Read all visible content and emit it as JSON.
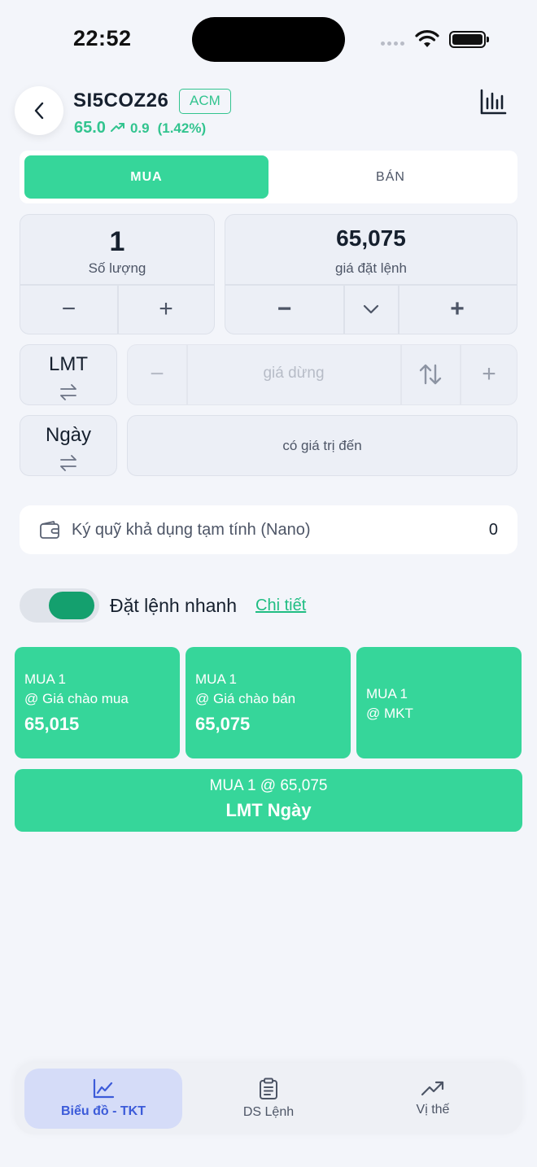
{
  "status_bar": {
    "time": "22:52"
  },
  "header": {
    "symbol": "SI5COZ26",
    "exchange_badge": "ACM",
    "last_price": "65.0",
    "change": "0.9",
    "change_pct": "(1.42%)",
    "trend_color": "#32c48f"
  },
  "side_tabs": {
    "buy": "MUA",
    "sell": "BÁN",
    "selected": "buy"
  },
  "quantity": {
    "value": "1",
    "label": "Số lượng",
    "minus": "−",
    "plus": "+"
  },
  "order_price": {
    "value": "65,075",
    "label": "giá đặt lệnh",
    "minus": "−",
    "plus": "+"
  },
  "order_type": {
    "value": "LMT"
  },
  "stop_price": {
    "placeholder": "giá dừng",
    "minus": "−",
    "plus": "+"
  },
  "validity": {
    "value": "Ngày"
  },
  "valid_until": {
    "placeholder": "có giá trị đến"
  },
  "margin": {
    "label": "Ký quỹ khả dụng tạm tính (Nano)",
    "value": "0"
  },
  "quick_order": {
    "label": "Đặt lệnh nhanh",
    "detail_link": "Chi tiết",
    "enabled": true
  },
  "quick_buttons": [
    {
      "line1": "MUA 1",
      "line2": "@ Giá chào mua",
      "value": "65,015"
    },
    {
      "line1": "MUA 1",
      "line2": "@ Giá chào bán",
      "value": "65,075"
    },
    {
      "line1": "MUA 1",
      "line2": "@ MKT"
    }
  ],
  "submit": {
    "line1": "MUA 1 @ 65,075",
    "line2": "LMT Ngày"
  },
  "bottom_nav": [
    {
      "label": "Biểu đồ - TKT",
      "icon": "chart-line-icon",
      "active": true
    },
    {
      "label": "DS Lệnh",
      "icon": "clipboard-icon",
      "active": false
    },
    {
      "label": "Vị thế",
      "icon": "trending-up-icon",
      "active": false
    }
  ],
  "colors": {
    "accent_green": "#36d69a",
    "toggle_green": "#14a06e",
    "nav_active": "#3c5bd9"
  }
}
